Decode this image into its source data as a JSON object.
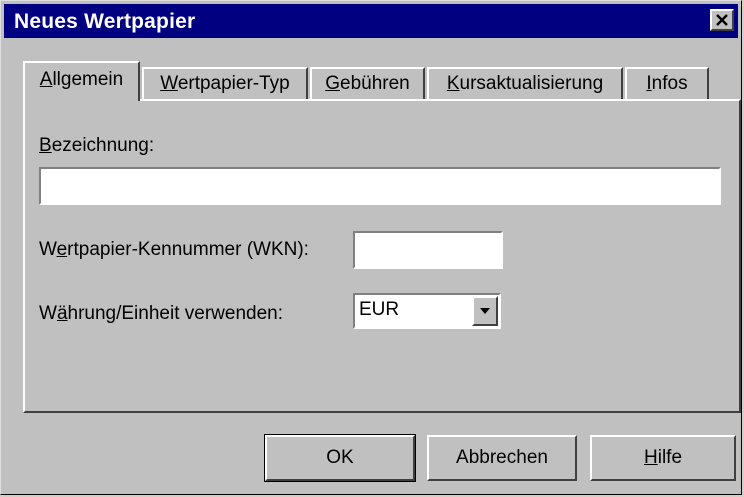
{
  "window": {
    "title": "Neues Wertpapier"
  },
  "tabs": [
    {
      "label": "Allgemein",
      "accel_index": 0,
      "active": true
    },
    {
      "label": "Wertpapier-Typ",
      "accel_index": 0,
      "active": false
    },
    {
      "label": "Gebühren",
      "accel_index": 0,
      "active": false
    },
    {
      "label": "Kursaktualisierung",
      "accel_index": 0,
      "active": false
    },
    {
      "label": "Infos",
      "accel_index": 0,
      "active": false
    }
  ],
  "form": {
    "bezeichnung": {
      "label": "Bezeichnung:",
      "value": ""
    },
    "wkn": {
      "label": "Wertpapier-Kennummer (WKN):",
      "value": ""
    },
    "waehrung": {
      "label": "Währung/Einheit verwenden:",
      "value": "EUR"
    }
  },
  "buttons": {
    "ok": "OK",
    "cancel": "Abbrechen",
    "help": "Hilfe"
  },
  "icons": {
    "close": "close-icon",
    "dropdown": "dropdown-arrow-icon"
  },
  "colors": {
    "titlebar": "#000080",
    "face": "#c0c0c0"
  }
}
